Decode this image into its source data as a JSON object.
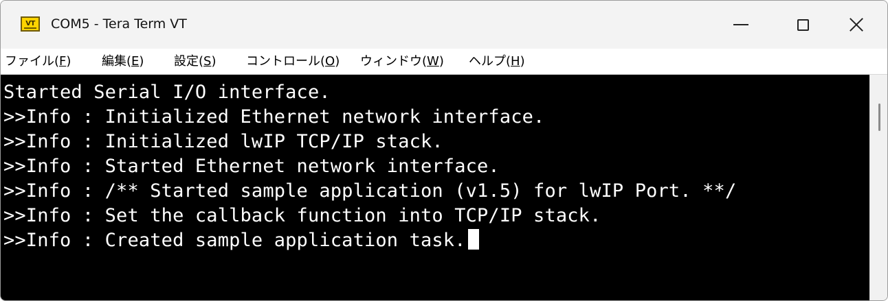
{
  "window": {
    "title": "COM5 - Tera Term VT",
    "icon_label": "VT",
    "icon_name": "teraterm-vt-icon"
  },
  "caption_buttons": {
    "minimize_icon": "minimize-icon",
    "maximize_icon": "maximize-icon",
    "close_icon": "close-icon"
  },
  "menu": [
    {
      "label": "ファイル(",
      "key": "F",
      "suffix": ")"
    },
    {
      "label": "編集(",
      "key": "E",
      "suffix": ")"
    },
    {
      "label": "設定(",
      "key": "S",
      "suffix": ")"
    },
    {
      "label": "コントロール(",
      "key": "O",
      "suffix": ")"
    },
    {
      "label": "ウィンドウ(",
      "key": "W",
      "suffix": ")"
    },
    {
      "label": "ヘルプ(",
      "key": "H",
      "suffix": ")"
    }
  ],
  "terminal": {
    "lines": [
      "Started Serial I/O interface.",
      ">>Info : Initialized Ethernet network interface.",
      ">>Info : Initialized lwIP TCP/IP stack.",
      ">>Info : Started Ethernet network interface.",
      ">>Info : /** Started sample application (v1.5) for lwIP Port. **/",
      ">>Info : Set the callback function into TCP/IP stack.",
      ">>Info : Created sample application task."
    ],
    "colors": {
      "background": "#000000",
      "foreground": "#ffffff"
    }
  }
}
